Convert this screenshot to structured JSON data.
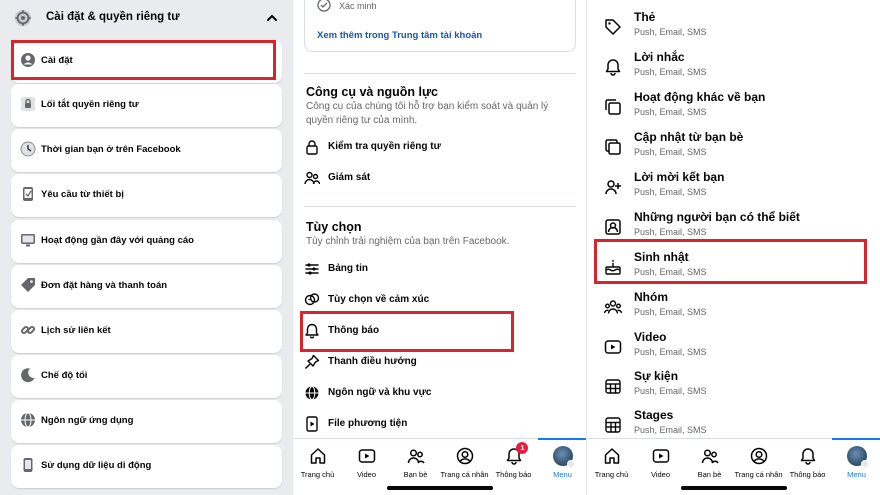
{
  "left_panel": {
    "header_title": "Cài đặt & quyền riêng tư",
    "items": [
      {
        "label": "Cài đặt",
        "icon": "account-circle-icon"
      },
      {
        "label": "Lối tắt quyền riêng tư",
        "icon": "privacy-lock-icon"
      },
      {
        "label": "Thời gian bạn ở trên Facebook",
        "icon": "clock-icon"
      },
      {
        "label": "Yêu cầu từ thiết bị",
        "icon": "device-icon"
      },
      {
        "label": "Hoạt động gần đây với quảng cáo",
        "icon": "ad-screen-icon"
      },
      {
        "label": "Đơn đặt hàng và thanh toán",
        "icon": "payment-tag-icon"
      },
      {
        "label": "Lịch sử liên kết",
        "icon": "link-icon"
      },
      {
        "label": "Chế độ tối",
        "icon": "moon-icon"
      },
      {
        "label": "Ngôn ngữ ứng dụng",
        "icon": "globe-icon"
      },
      {
        "label": "Sử dụng dữ liệu di động",
        "icon": "mobile-data-icon"
      }
    ]
  },
  "middle_panel": {
    "verified_label": "Xác minh",
    "account_center_link": "Xem thêm trong Trung tâm tài khoản",
    "tools_section": {
      "title": "Công cụ và nguồn lực",
      "description": "Công cụ của chúng tôi hỗ trợ bạn kiểm soát và quản lý quyền riêng tư của mình.",
      "items": [
        {
          "label": "Kiểm tra quyền riêng tư",
          "icon": "lock-icon"
        },
        {
          "label": "Giám sát",
          "icon": "supervision-icon"
        }
      ]
    },
    "preferences_section": {
      "title": "Tùy chọn",
      "description": "Tùy chỉnh trải nghiệm của bạn trên Facebook.",
      "items": [
        {
          "label": "Bảng tin",
          "icon": "feed-icon"
        },
        {
          "label": "Tùy chọn về cảm xúc",
          "icon": "reactions-icon"
        },
        {
          "label": "Thông báo",
          "icon": "bell-icon"
        },
        {
          "label": "Thanh điều hướng",
          "icon": "pin-icon"
        },
        {
          "label": "Ngôn ngữ và khu vực",
          "icon": "globe-icon"
        },
        {
          "label": "File phương tiện",
          "icon": "media-file-icon"
        }
      ]
    }
  },
  "right_panel": {
    "items": [
      {
        "title": "Thẻ",
        "subtitle": "Push, Email, SMS",
        "icon": "tag-icon"
      },
      {
        "title": "Lời nhắc",
        "subtitle": "Push, Email, SMS",
        "icon": "bell-icon"
      },
      {
        "title": "Hoạt động khác về bạn",
        "subtitle": "Push, Email, SMS",
        "icon": "stack-icon"
      },
      {
        "title": "Cập nhật từ bạn bè",
        "subtitle": "Push, Email, SMS",
        "icon": "friends-update-icon"
      },
      {
        "title": "Lời mời kết bạn",
        "subtitle": "Push, Email, SMS",
        "icon": "friend-request-icon"
      },
      {
        "title": "Những người bạn có thể biết",
        "subtitle": "Push, Email, SMS",
        "icon": "contact-card-icon"
      },
      {
        "title": "Sinh nhật",
        "subtitle": "Push, Email, SMS",
        "icon": "birthday-cake-icon"
      },
      {
        "title": "Nhóm",
        "subtitle": "Push, Email, SMS",
        "icon": "groups-icon"
      },
      {
        "title": "Video",
        "subtitle": "Push, Email, SMS",
        "icon": "video-play-icon"
      },
      {
        "title": "Sự kiện",
        "subtitle": "Push, Email, SMS",
        "icon": "calendar-icon"
      },
      {
        "title": "Stages",
        "subtitle": "Push, Email, SMS",
        "icon": "stages-grid-icon"
      }
    ]
  },
  "tab_bar": {
    "tabs": [
      {
        "label": "Trang chủ",
        "icon": "home-icon"
      },
      {
        "label": "Video",
        "icon": "video-icon"
      },
      {
        "label": "Bạn bè",
        "icon": "friends-icon"
      },
      {
        "label": "Trang cá nhân",
        "icon": "profile-icon"
      },
      {
        "label": "Thông báo",
        "icon": "notification-bell-icon"
      },
      {
        "label": "Menu",
        "icon": "avatar-menu-icon"
      }
    ],
    "notification_badge": "1",
    "active_tab": "Menu"
  },
  "colors": {
    "highlight": "#d6252c",
    "link": "#1a56a8",
    "accent": "#1877f2",
    "badge": "#e41e3f",
    "panel_bg": "#e9ebee"
  }
}
